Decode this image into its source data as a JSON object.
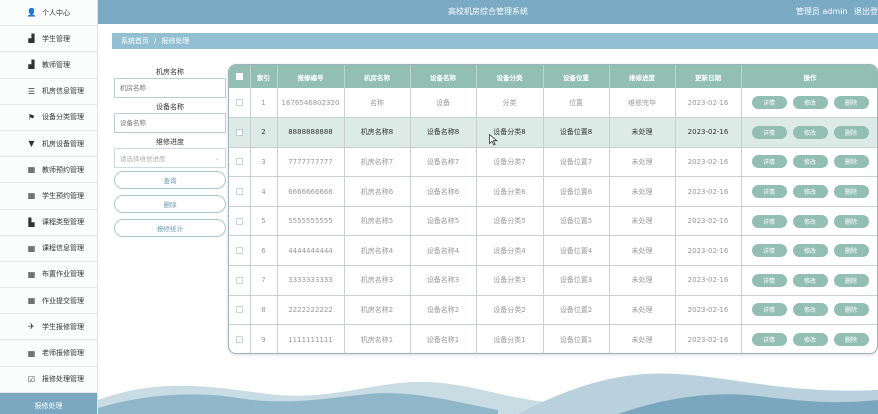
{
  "header": {
    "title": "高校机房综合管理系统",
    "user_label": "管理员 admin",
    "logout": "退出登"
  },
  "sidebar": {
    "items": [
      {
        "label": "个人中心",
        "icon": "user-icon",
        "glyph": "👤"
      },
      {
        "label": "学生管理",
        "icon": "user-group-icon",
        "glyph": "▟"
      },
      {
        "label": "教师管理",
        "icon": "teacher-icon",
        "glyph": "▟"
      },
      {
        "label": "机房信息管理",
        "icon": "list-icon",
        "glyph": "☰"
      },
      {
        "label": "设备分类管理",
        "icon": "flag-icon",
        "glyph": "⚑"
      },
      {
        "label": "机房设备管理",
        "icon": "filter-icon",
        "glyph": "▼"
      },
      {
        "label": "教师预约管理",
        "icon": "grid-icon",
        "glyph": "▦"
      },
      {
        "label": "学生预约管理",
        "icon": "grid-icon",
        "glyph": "▦"
      },
      {
        "label": "课程类型管理",
        "icon": "chart-icon",
        "glyph": "▙"
      },
      {
        "label": "课程信息管理",
        "icon": "grid-icon",
        "glyph": "▦"
      },
      {
        "label": "布置作业管理",
        "icon": "grid-icon",
        "glyph": "▦"
      },
      {
        "label": "作业提交管理",
        "icon": "grid-icon",
        "glyph": "▦"
      },
      {
        "label": "学生报修管理",
        "icon": "send-icon",
        "glyph": "✈"
      },
      {
        "label": "老师报修管理",
        "icon": "grid-icon",
        "glyph": "▦"
      },
      {
        "label": "报修处理管理",
        "icon": "check-square-icon",
        "glyph": "☑"
      }
    ],
    "active_item": "报修处理"
  },
  "breadcrumb": {
    "home": "系统首页",
    "separator": "/",
    "current": "报修处理"
  },
  "search": {
    "room_label": "机房名称",
    "room_placeholder": "机房名称",
    "device_label": "设备名称",
    "device_placeholder": "设备名称",
    "status_label": "维修进度",
    "status_placeholder": "请选择维修进度",
    "query_button": "查询",
    "delete_button": "删除",
    "stats_button": "报修统计"
  },
  "table": {
    "headers": [
      "",
      "索引",
      "报修编号",
      "机房名称",
      "设备名称",
      "设备分类",
      "设备位置",
      "维修进度",
      "更新日期",
      "操作"
    ],
    "op_labels": {
      "detail": "详情",
      "edit": "修改",
      "delete": "删除"
    },
    "rows": [
      {
        "index": "1",
        "code": "1676546802320",
        "room": "名称",
        "device": "设备",
        "category": "分类",
        "location": "位置",
        "status": "维修完毕",
        "date": "2023-02-16"
      },
      {
        "index": "2",
        "code": "8888888888",
        "room": "机房名称8",
        "device": "设备名称8",
        "category": "设备分类8",
        "location": "设备位置8",
        "status": "未处理",
        "date": "2023-02-16"
      },
      {
        "index": "3",
        "code": "7777777777",
        "room": "机房名称7",
        "device": "设备名称7",
        "category": "设备分类7",
        "location": "设备位置7",
        "status": "未处理",
        "date": "2023-02-16"
      },
      {
        "index": "4",
        "code": "6666666666",
        "room": "机房名称6",
        "device": "设备名称6",
        "category": "设备分类6",
        "location": "设备位置6",
        "status": "未处理",
        "date": "2023-02-16"
      },
      {
        "index": "5",
        "code": "5555555555",
        "room": "机房名称5",
        "device": "设备名称5",
        "category": "设备分类5",
        "location": "设备位置5",
        "status": "未处理",
        "date": "2023-02-16"
      },
      {
        "index": "6",
        "code": "4444444444",
        "room": "机房名称4",
        "device": "设备名称4",
        "category": "设备分类4",
        "location": "设备位置4",
        "status": "未处理",
        "date": "2023-02-16"
      },
      {
        "index": "7",
        "code": "3333333333",
        "room": "机房名称3",
        "device": "设备名称3",
        "category": "设备分类3",
        "location": "设备位置3",
        "status": "未处理",
        "date": "2023-02-16"
      },
      {
        "index": "8",
        "code": "2222222222",
        "room": "机房名称2",
        "device": "设备名称2",
        "category": "设备分类2",
        "location": "设备位置2",
        "status": "未处理",
        "date": "2023-02-16"
      },
      {
        "index": "9",
        "code": "1111111111",
        "room": "机房名称1",
        "device": "设备名称1",
        "category": "设备分类1",
        "location": "设备位置1",
        "status": "未处理",
        "date": "2023-02-16"
      }
    ],
    "highlighted_row": 1
  },
  "colors": {
    "header_bg": "#7aaac4",
    "breadcrumb_bg": "#93bfd2",
    "table_header_bg": "#93bfb3",
    "row_highlight_bg": "#dcebe6",
    "sidebar_active_bg": "#79a8c0"
  }
}
